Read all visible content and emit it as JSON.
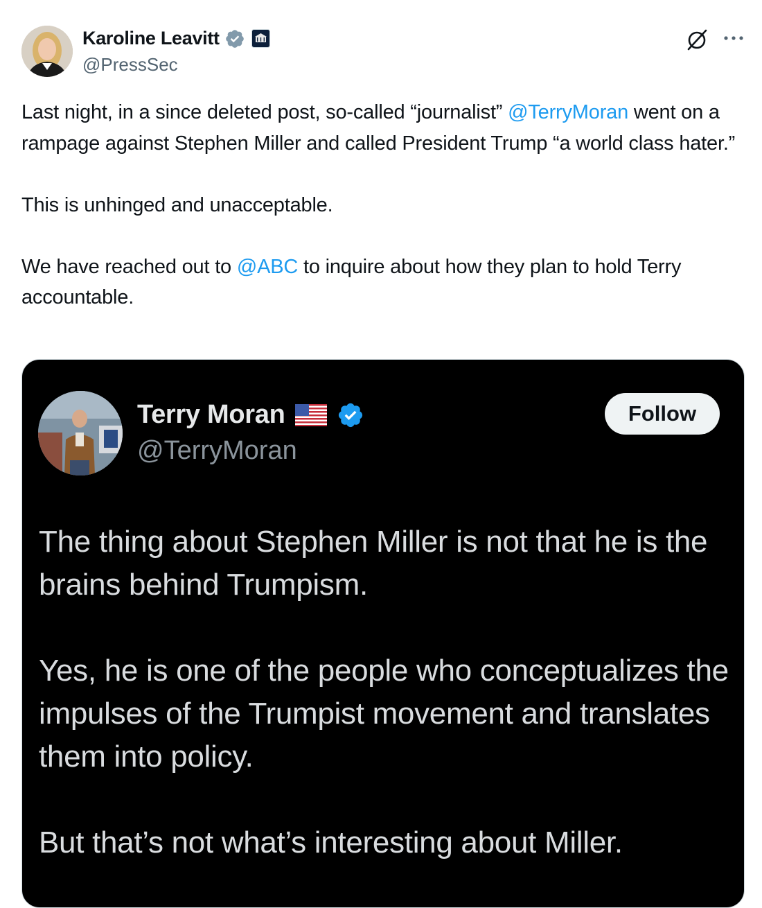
{
  "author": {
    "display_name": "Karoline Leavitt",
    "handle": "@PressSec",
    "avatar_icon": "user-avatar",
    "verified_icon": "verified-badge-icon",
    "affiliate_icon": "white-house-badge-icon"
  },
  "header_icons": {
    "grok": "grok-icon",
    "more": "more-options-icon"
  },
  "post": {
    "p1_a": "Last night, in a since deleted post, so-called “journalist” ",
    "p1_mention": "@TerryMoran",
    "p1_b": " went on a rampage against Stephen Miller and called President Trump “a world class hater.”",
    "p2": "This is unhinged and unacceptable.",
    "p3_a": "We have reached out to ",
    "p3_mention": "@ABC",
    "p3_b": " to inquire about how they plan to hold Terry accountable."
  },
  "embedded": {
    "display_name": "Terry Moran",
    "handle": "@TerryMoran",
    "follow_label": "Follow",
    "flag_icon": "us-flag-icon",
    "verified_icon": "verified-badge-icon",
    "text_p1": "The thing about Stephen Miller is not that he is the brains behind Trumpism.",
    "text_p2": "Yes, he is one of the people who conceptualizes the impulses of the Trumpist movement and translates them into policy.",
    "text_p3": "But that’s not what’s interesting about Miller."
  },
  "colors": {
    "link": "#1d9bf0",
    "verified": "#1d9bf0",
    "card_bg": "#000000"
  }
}
